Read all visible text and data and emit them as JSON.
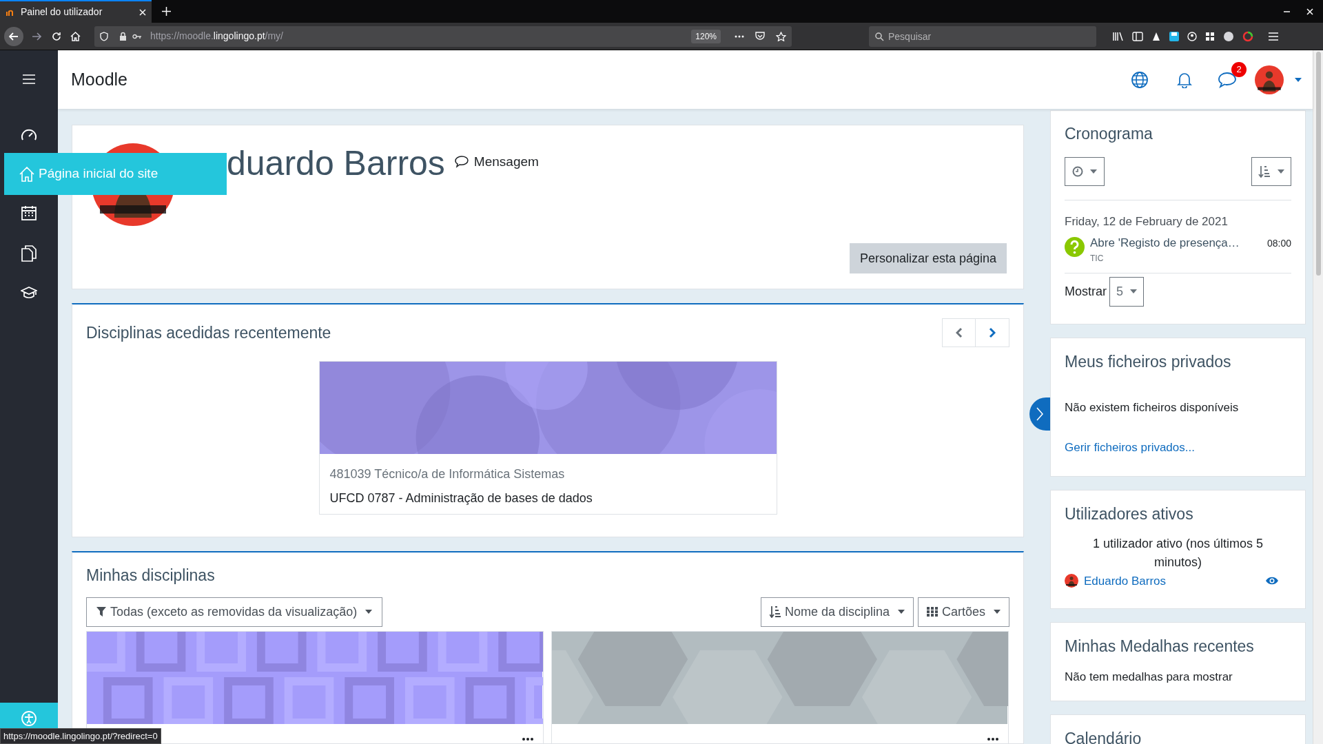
{
  "browser": {
    "tab": {
      "title": "Painel do utilizador",
      "selected": true
    },
    "url": {
      "prefix": "https://moodle.",
      "domain": "lingolingo.pt",
      "path": "/my/"
    },
    "zoom": "120%",
    "search": {
      "placeholder": "Pesquisar"
    },
    "status_url": "https://moodle.lingolingo.pt/?redirect=0"
  },
  "nav_drawer": {
    "tooltip": "Página inicial do site"
  },
  "header": {
    "site_name": "Moodle",
    "messages_badge": "2"
  },
  "profile": {
    "name": "duardo Barros",
    "message_link": "Mensagem",
    "customise_button": "Personalizar esta página"
  },
  "recent_courses": {
    "title": "Disciplinas acedidas recentemente",
    "courses": [
      {
        "category": "481039 Técnico/a de Informática Sistemas",
        "name": "UFCD 0787 - Administração de bases de dados"
      }
    ]
  },
  "my_courses": {
    "title": "Minhas disciplinas",
    "filter": "Todas (exceto as removidas da visualização)",
    "sort": "Nome da disciplina",
    "view": "Cartões"
  },
  "blocks": [
    {
      "kind": "timeline",
      "title": "Cronograma",
      "date": "Friday, 12 de February de 2021",
      "events": [
        {
          "name": "Abre 'Registo de presença…",
          "time": "08:00",
          "course": "TIC"
        }
      ],
      "show_label": "Mostrar",
      "show_value": "5"
    },
    {
      "kind": "private_files",
      "title": "Meus ficheiros privados",
      "message": "Não existem ficheiros disponíveis",
      "link": "Gerir ficheiros privados..."
    },
    {
      "kind": "online_users",
      "title": "Utilizadores ativos",
      "summary": "1 utilizador ativo (nos últimos 5 minutos)",
      "users": [
        {
          "name": "Eduardo Barros"
        }
      ]
    },
    {
      "kind": "badges",
      "title": "Minhas Medalhas recentes",
      "message": "Não tem medalhas para mostrar"
    },
    {
      "kind": "calendar",
      "title": "Calendário"
    }
  ]
}
